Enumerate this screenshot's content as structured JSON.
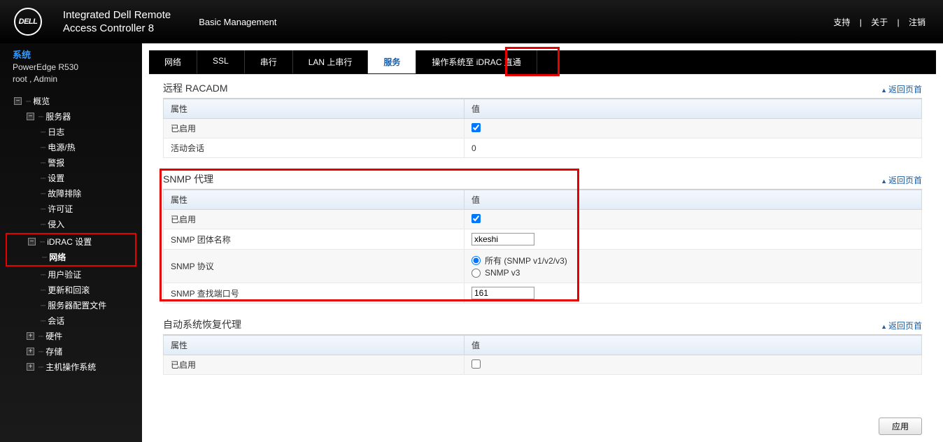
{
  "header": {
    "logo": "DELL",
    "title_line1": "Integrated Dell Remote",
    "title_line2": "Access Controller 8",
    "subtitle": "Basic Management",
    "links": {
      "support": "支持",
      "about": "关于",
      "logout": "注销"
    }
  },
  "sidebar": {
    "system": "系统",
    "model": "PowerEdge R530",
    "user": "root , Admin",
    "items": {
      "overview": "概览",
      "server": "服务器",
      "logs": "日志",
      "power": "电源/热",
      "alerts": "警报",
      "settings": "设置",
      "troubleshoot": "故障排除",
      "license": "许可证",
      "intrusion": "侵入",
      "idrac_settings": "iDRAC 设置",
      "network": "网络",
      "user_auth": "用户验证",
      "update_rollback": "更新和回滚",
      "server_profile": "服务器配置文件",
      "session": "会话",
      "hardware": "硬件",
      "storage": "存储",
      "host_os": "主机操作系统"
    }
  },
  "tabs": {
    "network": "网络",
    "ssl": "SSL",
    "serial": "串行",
    "lan_serial": "LAN 上串行",
    "services": "服务",
    "os_idrac": "操作系统至 iDRAC 直通"
  },
  "common": {
    "prop": "属性",
    "value": "值",
    "enabled": "已启用",
    "back_top": "返回页首"
  },
  "panel_racadm": {
    "title": "远程 RACADM",
    "active_sessions_label": "活动会话",
    "active_sessions_value": "0"
  },
  "panel_snmp": {
    "title": "SNMP 代理",
    "community_label": "SNMP 团体名称",
    "community_value": "xkeshi",
    "protocol_label": "SNMP 协议",
    "protocol_opt_all": "所有 (SNMP v1/v2/v3)",
    "protocol_opt_v3": "SNMP v3",
    "port_label": "SNMP 查找端口号",
    "port_value": "161"
  },
  "panel_asr": {
    "title": "自动系统恢复代理"
  },
  "buttons": {
    "apply": "应用"
  }
}
